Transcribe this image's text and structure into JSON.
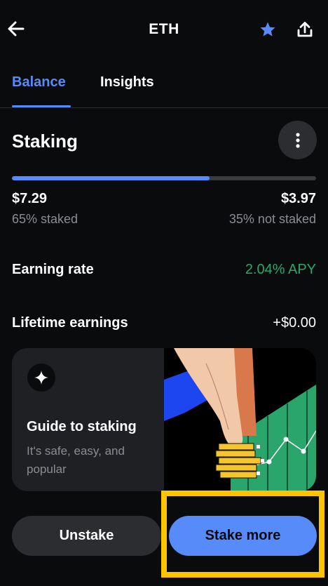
{
  "header": {
    "title": "ETH",
    "back_icon": "arrow-left-icon",
    "favorite_icon": "star-icon",
    "share_icon": "share-icon"
  },
  "tabs": [
    {
      "label": "Balance",
      "active": true
    },
    {
      "label": "Insights",
      "active": false
    }
  ],
  "staking": {
    "title": "Staking",
    "menu_icon": "more-vertical-icon",
    "staked_fraction": 0.65,
    "staked_amount": "$7.29",
    "staked_label": "65% staked",
    "not_staked_amount": "$3.97",
    "not_staked_label": "35% not staked"
  },
  "earning": {
    "label": "Earning rate",
    "value": "2.04% APY"
  },
  "lifetime": {
    "label": "Lifetime earnings",
    "value": "+$0.00"
  },
  "guide": {
    "icon": "sparkle-icon",
    "title": "Guide to staking",
    "description": "It's safe, easy, and popular"
  },
  "actions": {
    "unstake_label": "Unstake",
    "stake_more_label": "Stake more"
  },
  "colors": {
    "accent": "#578bfa",
    "positive": "#26a86b",
    "highlight": "#ffc400",
    "background": "#0a0b0d"
  }
}
